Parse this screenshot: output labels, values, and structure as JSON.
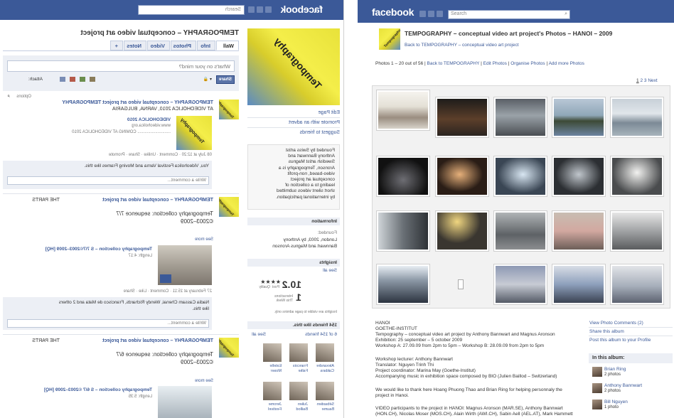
{
  "left_page": {
    "mirrored": true,
    "facebook_logo": "facebook",
    "search_placeholder": "Search",
    "profile_title": "TEMPOGRAPHY – conceptual video art project",
    "tabs": [
      "Wall",
      "Info",
      "Photos",
      "Video",
      "Notes",
      "+"
    ],
    "wall_input_placeholder": "What's on your mind?",
    "attach_label": "Attach:",
    "share_button": "Share",
    "options_label": "Options",
    "sidebar_links": [
      "Edit Page",
      "Promote with an advert",
      "Suggest to friends"
    ],
    "about_text": [
      "Founded by Swiss artist",
      "Anthony Bannwart and",
      "Swedish artist Magnus",
      "Aronson, Tempography is a",
      "video-based, non-profit",
      "conceptual art project",
      "leading to a collection of",
      "short silent videos submitted",
      "by international participation."
    ],
    "information": {
      "header": "Information",
      "founded_label": "Founded:",
      "founded_value": [
        "London, 2003, by Anthony",
        "Bannwart and Magnus Aronson"
      ]
    },
    "insights": {
      "header": "Insights",
      "see_all": "See all",
      "post_quality_value": "10.2",
      "post_quality_stars": "★★★★",
      "post_quality_label": [
        "Post",
        "Quality"
      ],
      "interactions_value": "1",
      "interactions_label": [
        "Interactions",
        "This Week"
      ],
      "visible_note": "Insights are visible to page admins only."
    },
    "friends": {
      "header": "154 friends like this.",
      "count_text": "6 of 154 friends",
      "see_all": "See all",
      "names": [
        [
          "Alexandre",
          "Caldara"
        ],
        [
          "Francois",
          "Falke"
        ],
        [
          "Estelle",
          "Moser"
        ],
        [
          "Sébastien",
          "Baume"
        ],
        [
          "Julien",
          "Baillod"
        ],
        [
          "Jerome",
          "Festivel"
        ]
      ]
    },
    "posts": [
      {
        "author": "TEMPOGRAPHY – conceptual video art project",
        "text_lines": [
          "TEMPOGRAPHY – conceptual video art project TEMPOGRAPHY",
          "AT VIDEOHOLICA 2010, VARNA, BULGARIA"
        ],
        "event_title": "VIDEOHOLICA 2010",
        "event_url": "www.videoholica.org",
        "event_line": "............................ COMING AT VIDEOHOLICA 2010",
        "meta": "08 July at 12:20 · Comment · Unlike · Share · Promote",
        "likes": "You, Videoholica Festival Varna and Moving Frames like this.",
        "comment_placeholder": "Write a comment..."
      },
      {
        "author": "TEMPOGRAPHY – conceptual video art project",
        "text": "THE PARTS",
        "title": "Tempography collection: sequence 7/7",
        "subtitle": "©2003–2009",
        "see_more": "See more",
        "video_title": "Tempography collection – S 7/7©2003–2009 [HQ]",
        "video_length": "Length: 4:17",
        "meta": "27 February at 15:11 · Comment · Like · Share",
        "likes": [
          "Nadia Cassam Chenai, Wendy Richards, Francisco de Mata and 2 others",
          "like this."
        ],
        "comment_placeholder": "Write a comment..."
      },
      {
        "author": "TEMPOGRAPHY – conceptual video art project",
        "text": "THE PARTS",
        "title": "Tempography collection: sequence 6/7",
        "subtitle": "©2003–2009",
        "see_more": "See more",
        "video_title": "Tempography collection – S 6/7 ©2003–2009 [HQ]",
        "video_length": "Length: 5:35"
      }
    ]
  },
  "right_page": {
    "facebook_logo": "facebook",
    "search_placeholder": "Search",
    "album_title": "TEMPOGRAPHY – conceptual video art project's Photos – HANOI – 2009",
    "back_link": "Back to TEMPOGRAPHY – conceptual video art project",
    "photos_range": "Photos 1 – 20 out of 56",
    "nav_links": [
      "Back to TEMPOGRAPHY",
      "Edit Photos",
      "Organise Photos",
      "Add more Photos"
    ],
    "pagination": [
      "1",
      "2",
      "3",
      "Next"
    ],
    "thumb_count": 19,
    "description_lines": [
      "HANOI",
      "GOETHE-INSTITUT",
      "Tempography – conceptual video art project by Anthony Bannwart and Magnus Aronson",
      "Exhibition: 25 september – 5 october 2009",
      "Workshop A: 27.09.09 from 2pm to 5pm – Workshop B: 28.09.09 from 2pm to 5pm",
      "",
      "Workshop lecturer: Anthony Bannwart",
      "Translator: Nguyen Trinh Thi",
      "Project coordinator: Marina May (Goethe-Institut)",
      "Accompanying music in exhibition space composed by BIO (Julien Baillod – Switzerland)",
      "",
      "We would like to thank here Hoang Phuong Thao and Brian Ring for helping personnaly the",
      "project in Hanoi.",
      "",
      "VIDEO participants to the project in HANOI: Magnus Aronson (MAR.SE), Anthony Bannwart",
      "(HON.CH), Nicolas Moser (MOS.CH), Alain Wirth (AWI.CH), Sabin Aell (AEL.AT), Mark Hammett"
    ],
    "side_links": [
      "View Photo Comments (2)",
      "Share this album",
      "Post this album to your Profile"
    ],
    "in_album_header": "In this album:",
    "in_album": [
      {
        "name": "Brian Ring",
        "count": "2 photos"
      },
      {
        "name": "Anthony Bannwart",
        "count": "2 photos"
      },
      {
        "name": "Bill Nguyen",
        "count": "1 photo"
      }
    ]
  },
  "colors": {
    "facebook_blue": "#3b5998",
    "link": "#3b5998",
    "highlight_yellow": "#f4ee4a"
  }
}
